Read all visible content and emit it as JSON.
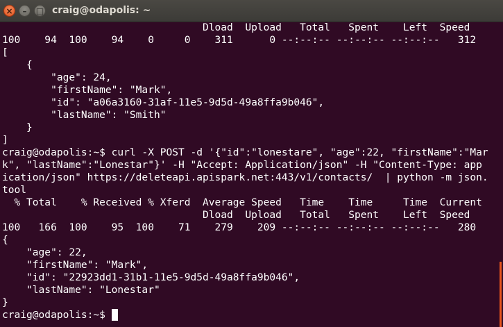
{
  "window": {
    "title": "craig@odapolis: ~",
    "close_glyph": "×",
    "minimize_glyph": "–",
    "maximize_glyph": "□"
  },
  "terminal": {
    "lines": [
      "                                 Dload  Upload   Total   Spent    Left  Speed",
      "100    94  100    94    0     0    311      0 --:--:-- --:--:-- --:--:--   312",
      "[",
      "    {",
      "        \"age\": 24,",
      "        \"firstName\": \"Mark\",",
      "        \"id\": \"a06a3160-31af-11e5-9d5d-49a8ffa9b046\",",
      "        \"lastName\": \"Smith\"",
      "    }",
      "]",
      "craig@odapolis:~$ curl -X POST -d '{\"id\":\"lonestare\", \"age\":22, \"firstName\":\"Mar",
      "k\", \"lastName\":\"Lonestar\"}' -H \"Accept: Application/json\" -H \"Content-Type: app",
      "ication/json\" https://deleteapi.apispark.net:443/v1/contacts/  | python -m json.",
      "tool",
      "  % Total    % Received % Xferd  Average Speed   Time    Time     Time  Current",
      "                                 Dload  Upload   Total   Spent    Left  Speed",
      "100   166  100    95  100    71    279    209 --:--:-- --:--:-- --:--:--   280",
      "{",
      "    \"age\": 22,",
      "    \"firstName\": \"Mark\",",
      "    \"id\": \"22923dd1-31b1-11e5-9d5d-49a8ffa9b046\",",
      "    \"lastName\": \"Lonestar\"",
      "}"
    ],
    "prompt": "craig@odapolis:~$ "
  },
  "colors": {
    "background": "#300a24",
    "foreground": "#ffffff",
    "accent": "#e9561e"
  }
}
